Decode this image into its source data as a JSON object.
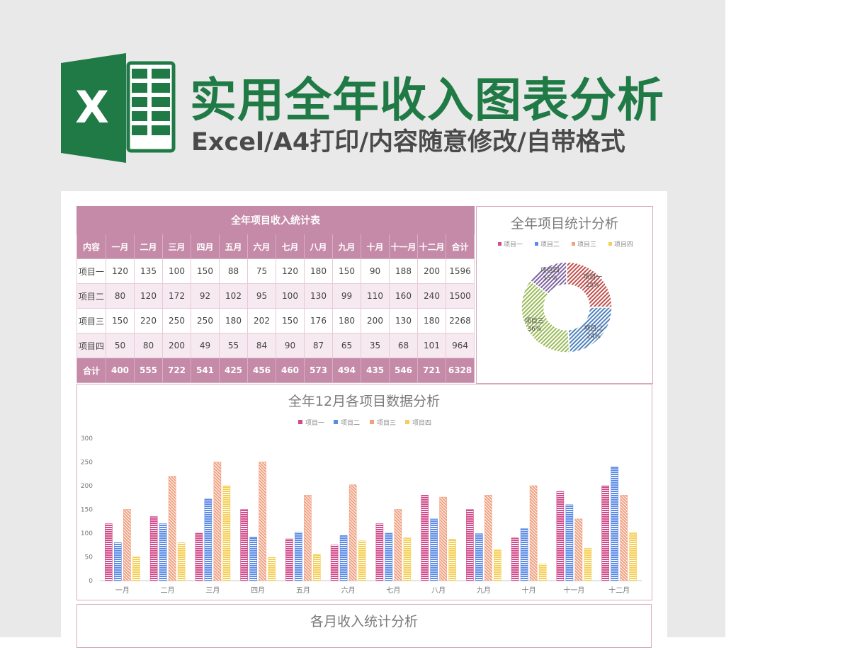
{
  "banner": {
    "title": "实用全年收入图表分析",
    "subtitle": "Excel/A4打印/内容随意修改/自带格式",
    "logo_letter": "X"
  },
  "table": {
    "title": "全年项目收入统计表",
    "headers": [
      "内容",
      "一月",
      "二月",
      "三月",
      "四月",
      "五月",
      "六月",
      "七月",
      "八月",
      "九月",
      "十月",
      "十一月",
      "十二月",
      "合计"
    ],
    "rows": [
      [
        "项目一",
        "120",
        "135",
        "100",
        "150",
        "88",
        "75",
        "120",
        "180",
        "150",
        "90",
        "188",
        "200",
        "1596"
      ],
      [
        "项目二",
        "80",
        "120",
        "172",
        "92",
        "102",
        "95",
        "100",
        "130",
        "99",
        "110",
        "160",
        "240",
        "1500"
      ],
      [
        "项目三",
        "150",
        "220",
        "250",
        "250",
        "180",
        "202",
        "150",
        "176",
        "180",
        "200",
        "130",
        "180",
        "2268"
      ],
      [
        "项目四",
        "50",
        "80",
        "200",
        "49",
        "55",
        "84",
        "90",
        "87",
        "65",
        "35",
        "68",
        "101",
        "964"
      ]
    ],
    "total": [
      "合计",
      "400",
      "555",
      "722",
      "541",
      "425",
      "456",
      "460",
      "573",
      "494",
      "435",
      "546",
      "721",
      "6328"
    ]
  },
  "colors": {
    "brand_green": "#1f7a45",
    "table_header": "#c48aa8",
    "series": [
      "#d04b8a",
      "#5b8be6",
      "#f0a080",
      "#f5cf55"
    ],
    "pie": [
      "#c0504d",
      "#4f81bd",
      "#9bbb59",
      "#8064a2"
    ]
  },
  "chart_data": [
    {
      "type": "pie",
      "title": "全年项目统计分析",
      "categories": [
        "项目一",
        "项目二",
        "项目三",
        "项目四"
      ],
      "values": [
        25,
        24,
        36,
        15
      ],
      "slice_labels": [
        "项目一\n25%",
        "项目二\n24%",
        "项目三\n36%",
        "项目四\n15%"
      ],
      "legend_position": "top"
    },
    {
      "type": "bar",
      "title": "全年12月各项目数据分析",
      "categories": [
        "一月",
        "二月",
        "三月",
        "四月",
        "五月",
        "六月",
        "七月",
        "八月",
        "九月",
        "十月",
        "十一月",
        "十二月"
      ],
      "series": [
        {
          "name": "项目一",
          "values": [
            120,
            135,
            100,
            150,
            88,
            75,
            120,
            180,
            150,
            90,
            188,
            200
          ]
        },
        {
          "name": "项目二",
          "values": [
            80,
            120,
            172,
            92,
            102,
            95,
            100,
            130,
            99,
            110,
            160,
            240
          ]
        },
        {
          "name": "项目三",
          "values": [
            150,
            220,
            250,
            250,
            180,
            202,
            150,
            176,
            180,
            200,
            130,
            180
          ]
        },
        {
          "name": "项目四",
          "values": [
            50,
            80,
            200,
            49,
            55,
            84,
            90,
            87,
            65,
            35,
            68,
            101
          ]
        }
      ],
      "ylim": [
        0,
        300
      ],
      "yticks": [
        "0",
        "50",
        "100",
        "150",
        "200",
        "250",
        "300"
      ],
      "legend_position": "top",
      "grid": false
    },
    {
      "type": "line",
      "title": "各月收入统计分析"
    }
  ]
}
